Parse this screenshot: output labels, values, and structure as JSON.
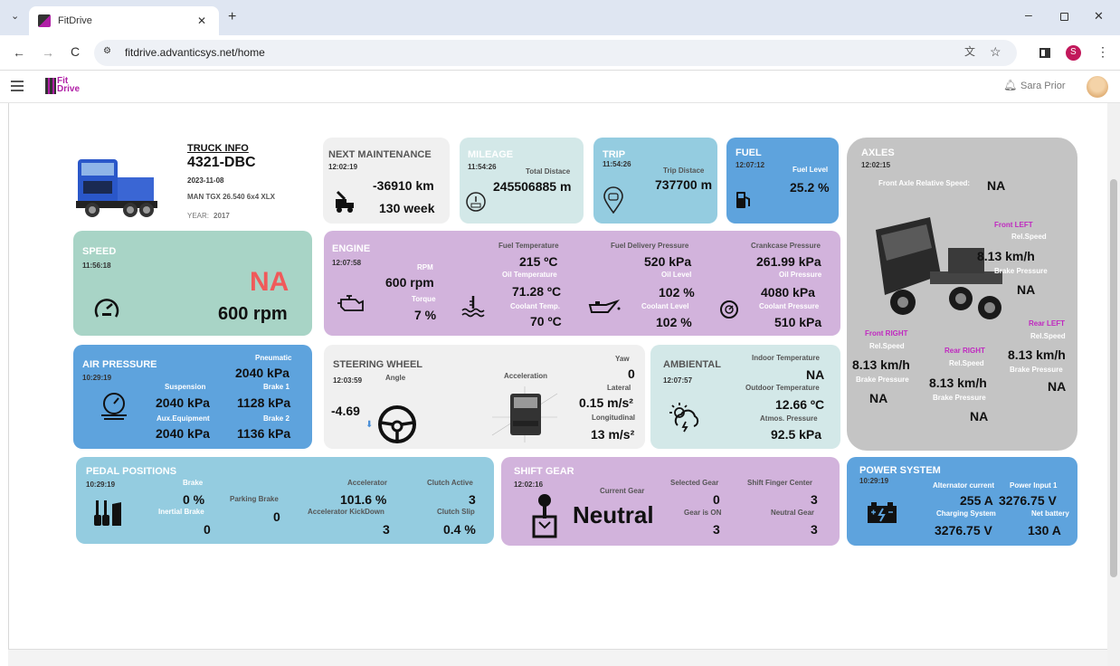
{
  "browser": {
    "tab_title": "FitDrive",
    "url": "fitdrive.advanticsys.net/home",
    "profile_initial": "S"
  },
  "header": {
    "logo_line1": "Fit",
    "logo_line2": "Drive",
    "user_name": "Sara Prior"
  },
  "truck": {
    "title": "TRUCK INFO",
    "plate": "4321-DBC",
    "date": "2023-11-08",
    "model": "MAN TGX 26.540 6x4 XLX",
    "year_label": "YEAR:",
    "year": "2017"
  },
  "maintenance": {
    "title": "NEXT MAINTENANCE",
    "time": "12:02:19",
    "km": "-36910 km",
    "weeks": "130 week"
  },
  "mileage": {
    "title": "MILEAGE",
    "time": "11:54:26",
    "label": "Total Distace",
    "value": "245506885 m"
  },
  "trip": {
    "title": "TRIP",
    "time": "11:54:26",
    "label": "Trip Distace",
    "value": "737700 m"
  },
  "fuel": {
    "title": "FUEL",
    "time": "12:07:12",
    "label": "Fuel Level",
    "value": "25.2 %"
  },
  "axles": {
    "title": "AXLES",
    "time": "12:02:15",
    "front_rel_label": "Front Axle Relative Speed:",
    "front_rel_value": "NA",
    "front_left": {
      "name": "Front LEFT",
      "speed_label": "Rel.Speed",
      "speed": "8.13 km/h",
      "brake_label": "Brake Pressure",
      "brake": "NA"
    },
    "front_right": {
      "name": "Front RIGHT",
      "speed_label": "Rel.Speed",
      "speed": "8.13 km/h",
      "brake_label": "Brake Pressure",
      "brake": "NA"
    },
    "rear_left": {
      "name": "Rear LEFT",
      "speed_label": "Rel.Speed",
      "speed": "8.13 km/h",
      "brake_label": "Brake Pressure",
      "brake": "NA"
    },
    "rear_right": {
      "name": "Rear RIGHT",
      "speed_label": "Rel.Speed",
      "speed": "8.13 km/h",
      "brake_label": "Brake Pressure",
      "brake": "NA"
    }
  },
  "speed": {
    "title": "SPEED",
    "time": "11:56:18",
    "value": "NA",
    "rpm": "600 rpm"
  },
  "engine": {
    "title": "ENGINE",
    "time": "12:07:58",
    "rpm_label": "RPM",
    "rpm": "600 rpm",
    "torque_label": "Torque",
    "torque": "7 %",
    "fuel_temp_label": "Fuel Temperature",
    "fuel_temp": "215 ºC",
    "oil_temp_label": "Oil Temperature",
    "oil_temp": "71.28 ºC",
    "coolant_temp_label": "Coolant Temp.",
    "coolant_temp": "70 ºC",
    "fuel_delivery_label": "Fuel Delivery Pressure",
    "fuel_delivery": "520 kPa",
    "oil_level_label": "Oil Level",
    "oil_level": "102 %",
    "coolant_level_label": "Coolant Level",
    "coolant_level": "102 %",
    "crankcase_label": "Crankcase Pressure",
    "crankcase": "261.99 kPa",
    "oil_pressure_label": "Oil Pressure",
    "oil_pressure": "4080 kPa",
    "coolant_pressure_label": "Coolant Pressure",
    "coolant_pressure": "510 kPa"
  },
  "air": {
    "title": "AIR PRESSURE",
    "time": "10:29:19",
    "pneumatic_label": "Pneumatic",
    "pneumatic": "2040 kPa",
    "suspension_label": "Suspension",
    "suspension": "2040 kPa",
    "brake1_label": "Brake 1",
    "brake1": "1128 kPa",
    "aux_label": "Aux.Equipment",
    "aux": "2040 kPa",
    "brake2_label": "Brake 2",
    "brake2": "1136 kPa"
  },
  "steering": {
    "title": "STEERING WHEEL",
    "time": "12:03:59",
    "angle_label": "Angle",
    "angle": "-4.69",
    "accel_label": "Acceleration",
    "yaw_label": "Yaw",
    "yaw": "0",
    "lateral_label": "Lateral",
    "lateral": "0.15 m/s²",
    "longitudinal_label": "Longitudinal",
    "longitudinal": "13 m/s²"
  },
  "ambiental": {
    "title": "AMBIENTAL",
    "time": "12:07:57",
    "indoor_label": "Indoor Temperature",
    "indoor": "NA",
    "outdoor_label": "Outdoor Temperature",
    "outdoor": "12.66 ºC",
    "atmos_label": "Atmos. Pressure",
    "atmos": "92.5 kPa"
  },
  "pedal": {
    "title": "PEDAL POSITIONS",
    "time": "10:29:19",
    "brake_label": "Brake",
    "brake": "0 %",
    "inertial_label": "Inertial Brake",
    "inertial": "0",
    "parking_label": "Parking Brake",
    "parking": "0",
    "accel_label": "Accelerator",
    "accel": "101.6 %",
    "kickdown_label": "Accelerator KickDown",
    "kickdown": "3",
    "clutch_active_label": "Clutch Active",
    "clutch_active": "3",
    "clutch_slip_label": "Clutch Slip",
    "clutch_slip": "0.4 %"
  },
  "gear": {
    "title": "SHIFT GEAR",
    "time": "12:02:16",
    "current_label": "Current Gear",
    "current": "Neutral",
    "selected_label": "Selected Gear",
    "selected": "0",
    "is_on_label": "Gear is ON",
    "is_on": "3",
    "finger_label": "Shift Finger Center",
    "finger": "3",
    "neutral_label": "Neutral Gear",
    "neutral": "3"
  },
  "power": {
    "title": "POWER SYSTEM",
    "time": "10:29:19",
    "alt_label": "Alternator current",
    "alt": "255 A",
    "input_label": "Power Input 1",
    "input": "3276.75 V",
    "charging_label": "Charging System",
    "charging": "3276.75 V",
    "net_label": "Net battery",
    "net": "130 A"
  },
  "colors": {
    "teal_light": "#d3e8e8",
    "teal": "#a8d4c6",
    "sky": "#94cce0",
    "blue": "#5ea3dd",
    "lilac": "#d2b3dc",
    "grey": "#c4c4c4",
    "red": "#f05a5a",
    "magenta": "#c028c0"
  }
}
